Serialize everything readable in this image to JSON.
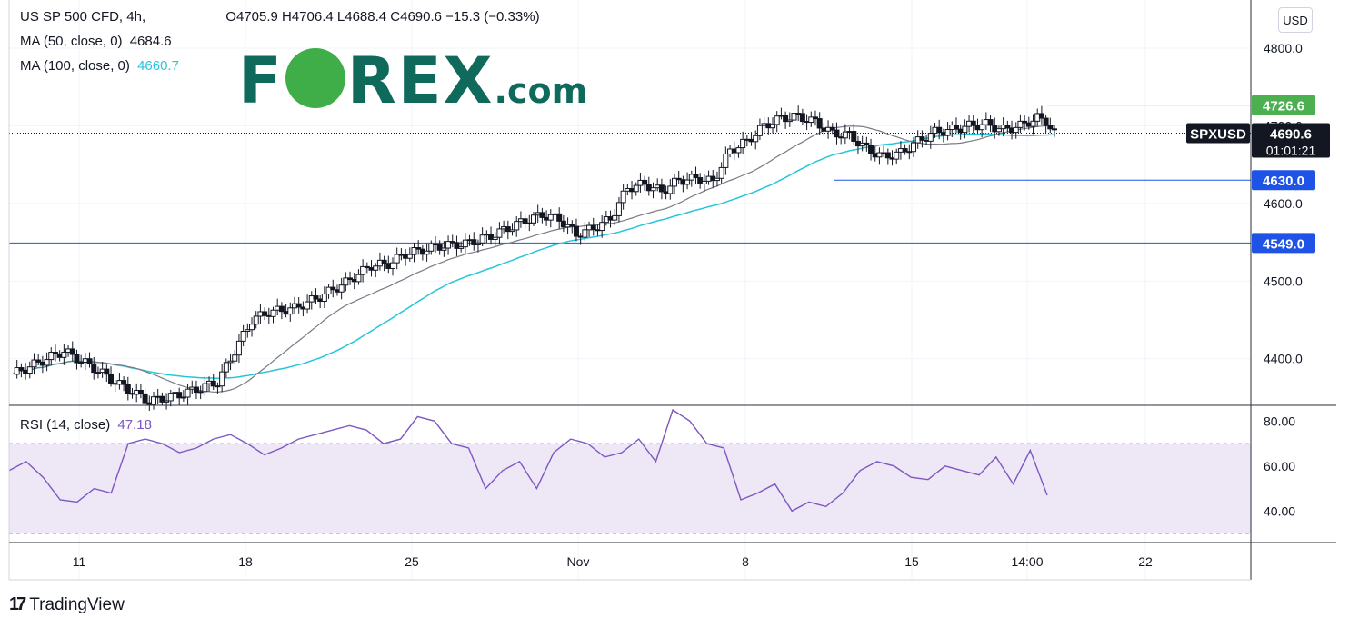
{
  "legend": {
    "symbol": "US SP 500 CFD, 4h,",
    "ohlc": "O4705.9 H4706.4 L4688.4 C4690.6 −15.3 (−0.33%)",
    "ma50_label": "MA (50, close, 0)",
    "ma50_value": "4684.6",
    "ma100_label": "MA (100, close, 0)",
    "ma100_value": "4660.7",
    "rsi_label": "RSI (14, close)",
    "rsi_value": "47.18"
  },
  "logo": {
    "text_a": "F",
    "text_b": "REX",
    "suffix": ".com"
  },
  "currency_button": "USD",
  "footer": {
    "brand": "TradingView",
    "icon": "tradingview-logo-icon"
  },
  "colors": {
    "ma50": "#787b86",
    "ma100": "#26c6da",
    "rsi": "#7e57c2",
    "rsi_band": "#ede7f6",
    "level_green": "#4caf50",
    "level_blue": "#1e53e5",
    "candle": "#131722"
  },
  "chart_data": [
    {
      "type": "candlestick",
      "title": "US SP 500 CFD, 4h",
      "ylim": [
        4340,
        4862
      ],
      "y_ticks": [
        "4800.0",
        "4700.0",
        "4600.0",
        "4500.0",
        "4400.0"
      ],
      "x_ticks": [
        "11",
        "18",
        "25",
        "Nov",
        "8",
        "15",
        "14:00",
        "22"
      ],
      "price_labels": [
        {
          "label": "4726.6",
          "value": 4726.6,
          "color": "green"
        },
        {
          "label": "4630.0",
          "value": 4630.0,
          "color": "blue"
        },
        {
          "label": "4549.0",
          "value": 4549.0,
          "color": "blue"
        }
      ],
      "current_price": {
        "symbol": "SPXUSD",
        "value": "4690.6",
        "countdown": "01:01:21"
      },
      "close_series_points": [
        [
          0,
          4380
        ],
        [
          6,
          4410
        ],
        [
          10,
          4385
        ],
        [
          12,
          4370
        ],
        [
          16,
          4345
        ],
        [
          20,
          4355
        ],
        [
          24,
          4370
        ],
        [
          26,
          4410
        ],
        [
          28,
          4450
        ],
        [
          30,
          4460
        ],
        [
          33,
          4465
        ],
        [
          36,
          4480
        ],
        [
          39,
          4498
        ],
        [
          42,
          4520
        ],
        [
          44,
          4522
        ],
        [
          46,
          4535
        ],
        [
          50,
          4545
        ],
        [
          53,
          4548
        ],
        [
          56,
          4558
        ],
        [
          60,
          4578
        ],
        [
          62,
          4585
        ],
        [
          64,
          4580
        ],
        [
          66,
          4560
        ],
        [
          68,
          4568
        ],
        [
          70,
          4580
        ],
        [
          72,
          4620
        ],
        [
          74,
          4625
        ],
        [
          76,
          4615
        ],
        [
          78,
          4630
        ],
        [
          80,
          4632
        ],
        [
          82,
          4628
        ],
        [
          84,
          4668
        ],
        [
          86,
          4680
        ],
        [
          88,
          4700
        ],
        [
          90,
          4710
        ],
        [
          92,
          4712
        ],
        [
          94,
          4705
        ],
        [
          96,
          4690
        ],
        [
          98,
          4688
        ],
        [
          100,
          4670
        ],
        [
          102,
          4660
        ],
        [
          104,
          4665
        ],
        [
          106,
          4680
        ],
        [
          108,
          4692
        ],
        [
          110,
          4695
        ],
        [
          112,
          4700
        ],
        [
          114,
          4702
        ],
        [
          116,
          4695
        ],
        [
          118,
          4700
        ],
        [
          120,
          4710
        ],
        [
          121,
          4706
        ],
        [
          122,
          4690
        ]
      ]
    },
    {
      "type": "line",
      "title": "RSI (14, close)",
      "ylim": [
        26,
        87
      ],
      "y_ticks": [
        "80.00",
        "60.00",
        "40.00"
      ],
      "band": [
        30,
        70
      ],
      "mid": 50,
      "series": [
        {
          "name": "RSI (14, close)",
          "values": [
            58,
            62,
            55,
            45,
            44,
            50,
            48,
            70,
            72,
            70,
            66,
            68,
            72,
            74,
            70,
            65,
            68,
            72,
            74,
            76,
            78,
            76,
            70,
            72,
            82,
            80,
            70,
            68,
            50,
            58,
            62,
            50,
            66,
            72,
            70,
            64,
            66,
            72,
            62,
            85,
            80,
            70,
            68,
            45,
            48,
            52,
            40,
            44,
            42,
            48,
            58,
            62,
            60,
            55,
            54,
            60,
            58,
            56,
            64,
            52,
            67,
            47
          ]
        }
      ]
    }
  ]
}
